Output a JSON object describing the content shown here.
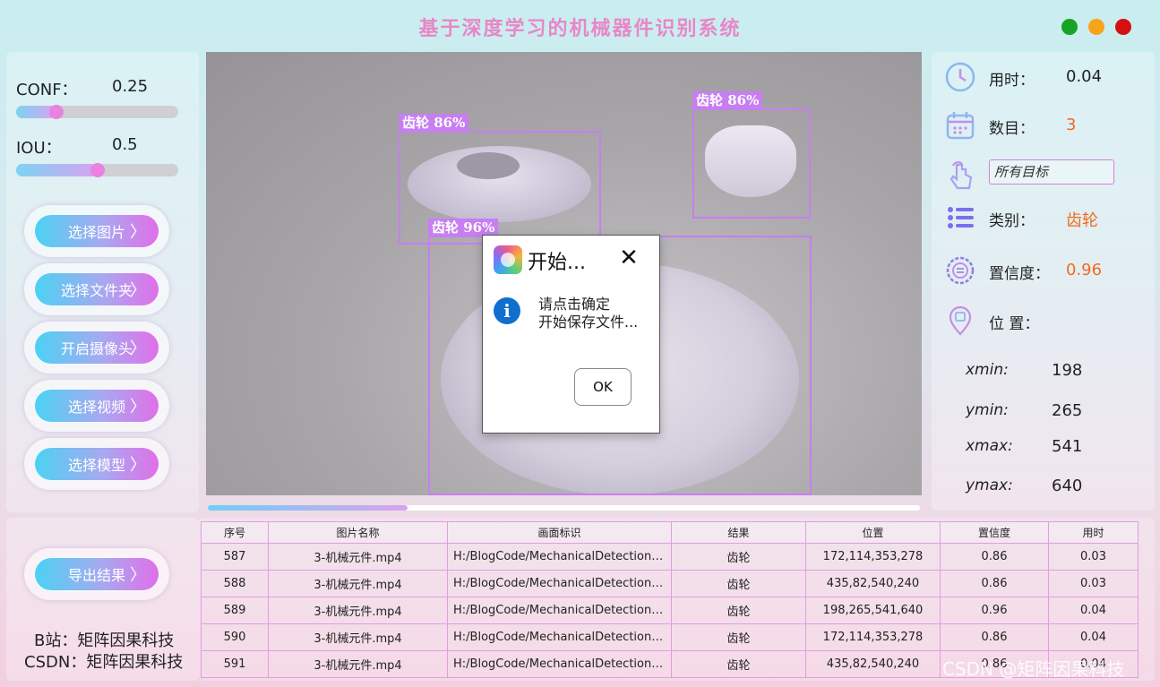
{
  "app": {
    "title": "基于深度学习的机械器件识别系统"
  },
  "window_controls": {
    "colors": {
      "green": "#16a326",
      "orange": "#f7a41b",
      "red": "#d60f0f"
    }
  },
  "sliders": {
    "conf": {
      "label": "CONF：",
      "value": "0.25",
      "fraction": 0.25
    },
    "iou": {
      "label": "IOU：",
      "value": "0.5",
      "fraction": 0.5
    }
  },
  "buttons": {
    "select_image": "选择图片",
    "select_folder": "选择文件夹",
    "open_camera": "开启摄像头",
    "select_video": "选择视频",
    "select_model": "选择模型",
    "export": "导出结果"
  },
  "detections": [
    {
      "label": "齿轮  86%"
    },
    {
      "label": "齿轮  86%"
    },
    {
      "label": "齿轮  96%"
    }
  ],
  "video_progress": 0.28,
  "info": {
    "time_label": "用时：",
    "time_value": "0.04",
    "count_label": "数目：",
    "count_value": "3",
    "target_select": "所有目标",
    "class_label": "类别：",
    "class_value": "齿轮",
    "conf_label": "置信度：",
    "conf_value": "0.96",
    "pos_label": "位 置：",
    "xmin_label": "xmin:",
    "xmin": "198",
    "ymin_label": "ymin:",
    "ymin": "265",
    "xmax_label": "xmax:",
    "xmax": "541",
    "ymax_label": "ymax:",
    "ymax": "640"
  },
  "table": {
    "headers": [
      "序号",
      "图片名称",
      "画面标识",
      "结果",
      "位置",
      "置信度",
      "用时"
    ],
    "rows": [
      [
        "587",
        "3-机械元件.mp4",
        "H:/BlogCode/MechanicalDetection/t...",
        "齿轮",
        "172,114,353,278",
        "0.86",
        "0.03"
      ],
      [
        "588",
        "3-机械元件.mp4",
        "H:/BlogCode/MechanicalDetection/t...",
        "齿轮",
        "435,82,540,240",
        "0.86",
        "0.03"
      ],
      [
        "589",
        "3-机械元件.mp4",
        "H:/BlogCode/MechanicalDetection/t...",
        "齿轮",
        "198,265,541,640",
        "0.96",
        "0.04"
      ],
      [
        "590",
        "3-机械元件.mp4",
        "H:/BlogCode/MechanicalDetection/t...",
        "齿轮",
        "172,114,353,278",
        "0.86",
        "0.04"
      ],
      [
        "591",
        "3-机械元件.mp4",
        "H:/BlogCode/MechanicalDetection/t...",
        "齿轮",
        "435,82,540,240",
        "0.86",
        "0.04"
      ]
    ]
  },
  "credits": {
    "bilibili": "B站：矩阵因果科技",
    "csdn": "CSDN：矩阵因果科技"
  },
  "watermark": "CSDN @矩阵因果科技",
  "dialog": {
    "title": "开始...",
    "line1": "请点击确定",
    "line2": "开始保存文件...",
    "ok": "OK"
  }
}
